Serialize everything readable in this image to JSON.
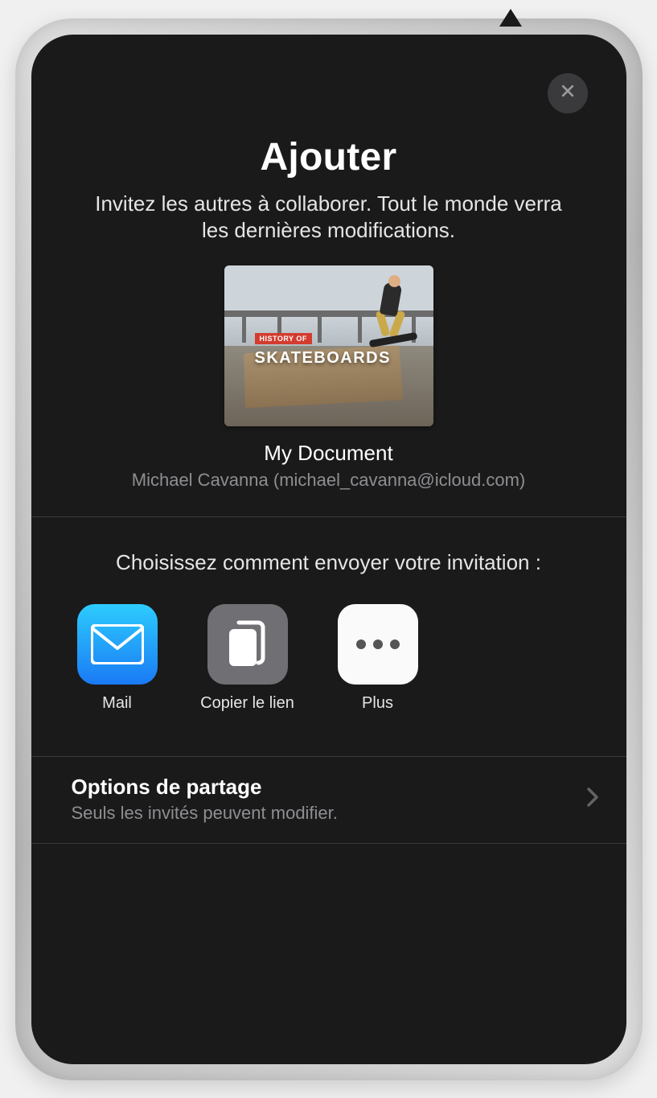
{
  "header": {
    "title": "Ajouter",
    "subtitle": "Invitez les autres à collaborer. Tout le monde verra les dernières modifications."
  },
  "document": {
    "thumb_tag_small": "HISTORY OF",
    "thumb_tag_big": "SKATEBOARDS",
    "name": "My Document",
    "owner": "Michael Cavanna (michael_cavanna@icloud.com)"
  },
  "invite": {
    "prompt": "Choisissez comment envoyer votre invitation :",
    "methods": {
      "mail": "Mail",
      "copy_link": "Copier le lien",
      "more": "Plus"
    }
  },
  "share_options": {
    "title": "Options de partage",
    "detail": "Seuls les invités peuvent modifier."
  }
}
